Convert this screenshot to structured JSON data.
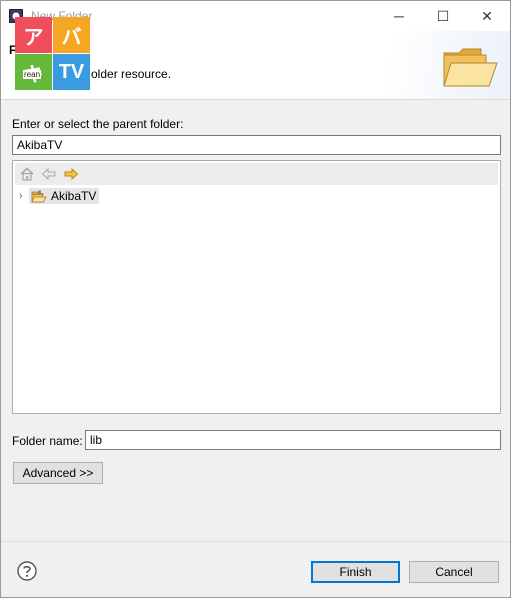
{
  "window": {
    "title": "New Folder",
    "controls": {
      "minimize": "─",
      "maximize": "☐",
      "close": "✕"
    }
  },
  "banner": {
    "title": "F",
    "description": "older resource."
  },
  "logo": {
    "tl": "ア",
    "tr": "バ",
    "bl": "キ",
    "br": "TV",
    "small_text": "rean"
  },
  "form": {
    "parent_label": "Enter or select the parent folder:",
    "parent_value": "AkibaTV",
    "tree": {
      "toolbar": [
        "home-icon",
        "back-arrow-icon",
        "forward-arrow-icon"
      ],
      "items": [
        {
          "label": "AkibaTV",
          "expanded": false,
          "selected": true
        }
      ]
    },
    "folder_name_label": "Folder name:",
    "folder_name_value": "lib",
    "advanced_label": "Advanced >>"
  },
  "footer": {
    "finish_label": "Finish",
    "cancel_label": "Cancel"
  },
  "colors": {
    "default_button_border": "#0078d7",
    "folder_yellow": "#f2c75c"
  }
}
